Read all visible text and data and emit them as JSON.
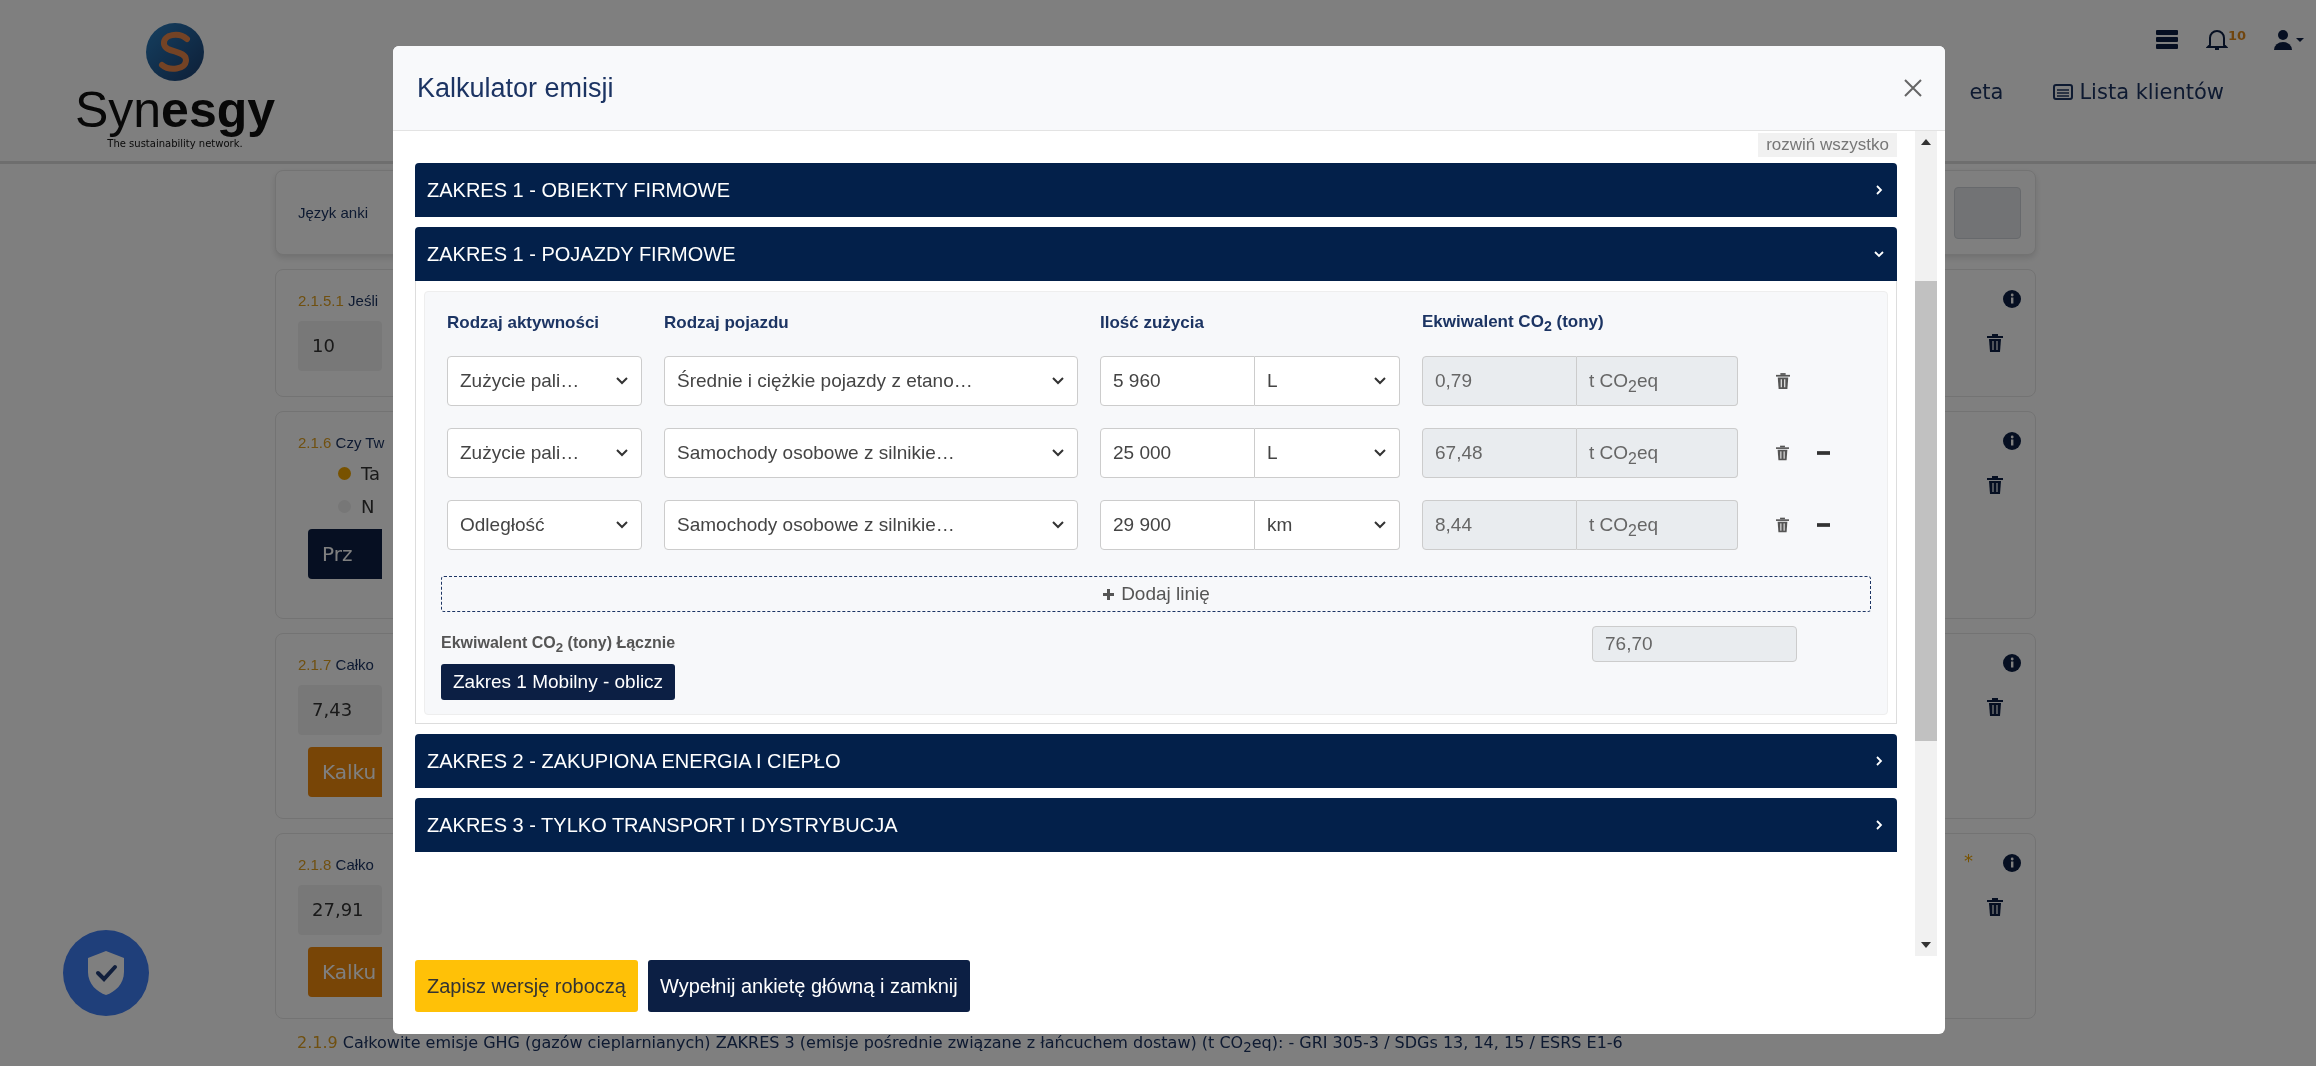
{
  "background": {
    "logo": {
      "name_light": "Syn",
      "name_bold": "esgy",
      "tagline": "The sustainability network."
    },
    "nav_cut": "eta",
    "nav_link": "Lista klientów",
    "notifications": "10",
    "language_label": "Język anki",
    "cards": [
      {
        "kind": "input",
        "number": "2.1.5.1",
        "question": "Jeśli",
        "value": "10"
      },
      {
        "kind": "radio",
        "number": "2.1.6",
        "question": "Czy Tw",
        "options": [
          {
            "label": "Ta",
            "selected": true
          },
          {
            "label": "N",
            "selected": false
          }
        ],
        "button": "Prz"
      },
      {
        "kind": "calc",
        "number": "2.1.7",
        "question": "Całko",
        "value": "7,43",
        "button": "Kalku"
      },
      {
        "kind": "calc",
        "number": "2.1.8",
        "question": "Całko",
        "value": "27,91",
        "button": "Kalku",
        "required": "*"
      }
    ],
    "last_card": {
      "number": "2.1.9",
      "question": "Całkowite emisje GHG (gazów cieplarnianych) ZAKRES 3 (emisje pośrednie związane z łańcuchem dostaw) (t CO$_{2}$eq): - GRI 305-3 / SDGs 13, 14, 15 / ESRS E1-6"
    }
  },
  "modal": {
    "title": "Kalkulator emisji",
    "expand_all": "rozwiń wszystko",
    "sections": [
      {
        "title": "ZAKRES 1 - OBIEKTY FIRMOWE",
        "expanded": false
      },
      {
        "title": "ZAKRES 1 - POJAZDY FIRMOWE",
        "expanded": true
      },
      {
        "title": "ZAKRES 2 - ZAKUPIONA ENERGIA I CIEPŁO",
        "expanded": false
      },
      {
        "title": "ZAKRES 3 - TYLKO TRANSPORT I DYSTRYBUCJA",
        "expanded": false
      }
    ],
    "calculator": {
      "columns": [
        "Rodzaj aktywności",
        "Rodzaj pojazdu",
        "Ilość zużycia",
        "Ekwiwalent CO$_{2}$ (tony)"
      ],
      "rows": [
        {
          "activity": "Zużycie pali…",
          "vehicle": "Średnie i ciężkie pojazdy z etano…",
          "quantity": "5 960",
          "unit": "L",
          "co2": "0,79",
          "co2_unit": "t CO$_{2}$eq",
          "removable": false
        },
        {
          "activity": "Zużycie pali…",
          "vehicle": "Samochody osobowe z silnikie…",
          "quantity": "25 000",
          "unit": "L",
          "co2": "67,48",
          "co2_unit": "t CO$_{2}$eq",
          "removable": true
        },
        {
          "activity": "Odległość",
          "vehicle": "Samochody osobowe z silnikie…",
          "quantity": "29 900",
          "unit": "km",
          "co2": "8,44",
          "co2_unit": "t CO$_{2}$eq",
          "removable": true
        }
      ],
      "add_line": "Dodaj linię",
      "total_label": "Ekwiwalent CO$_{2}$ (tony) Łącznie",
      "total_value": "76,70",
      "compute_button": "Zakres 1 Mobilny - oblicz"
    },
    "footer_buttons": [
      {
        "label": "Zapisz wersję roboczą",
        "kind": "warning"
      },
      {
        "label": "Wypełnij ankietę główną i zamknij",
        "kind": "primary"
      }
    ]
  }
}
